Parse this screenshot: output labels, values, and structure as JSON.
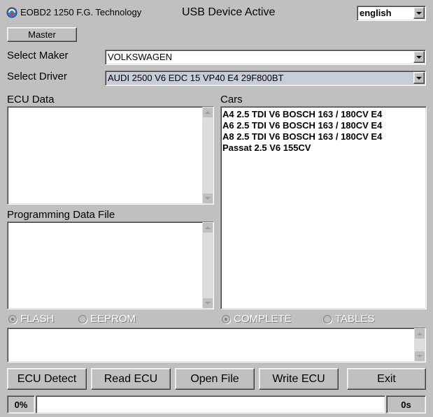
{
  "header": {
    "app_title": "EOBD2 1250 F.G. Technology",
    "status": "USB Device Active",
    "language": "english",
    "master_label": "Master"
  },
  "maker": {
    "label": "Select Maker",
    "value": "VOLKSWAGEN"
  },
  "driver": {
    "label": "Select Driver",
    "value": "AUDI 2500 V6 EDC 15 VP40 E4 29F800BT"
  },
  "ecu_data": {
    "label": "ECU Data"
  },
  "programming": {
    "label": "Programming Data File"
  },
  "cars": {
    "label": "Cars",
    "items": [
      "A4 2.5 TDI V6 BOSCH 163 / 180CV E4",
      "A6 2.5 TDI V6 BOSCH 163 / 180CV E4",
      "A8 2.5 TDI V6 BOSCH 163 / 180CV E4",
      "Passat 2.5 V6  155CV"
    ]
  },
  "options": {
    "flash": "FLASH",
    "eeprom": "EEPROM",
    "complete": "COMPLETE",
    "tables": "TABLES"
  },
  "buttons": {
    "ecu_detect": "ECU Detect",
    "read_ecu": "Read ECU",
    "open_file": "Open File",
    "write_ecu": "Write ECU",
    "exit": "Exit"
  },
  "progress": {
    "percent_label": "0%",
    "fraction": 0,
    "time_label": "0s"
  },
  "colors": {
    "window_bg": "#c0c0c0",
    "driver_highlight": "#c8ccd8"
  }
}
